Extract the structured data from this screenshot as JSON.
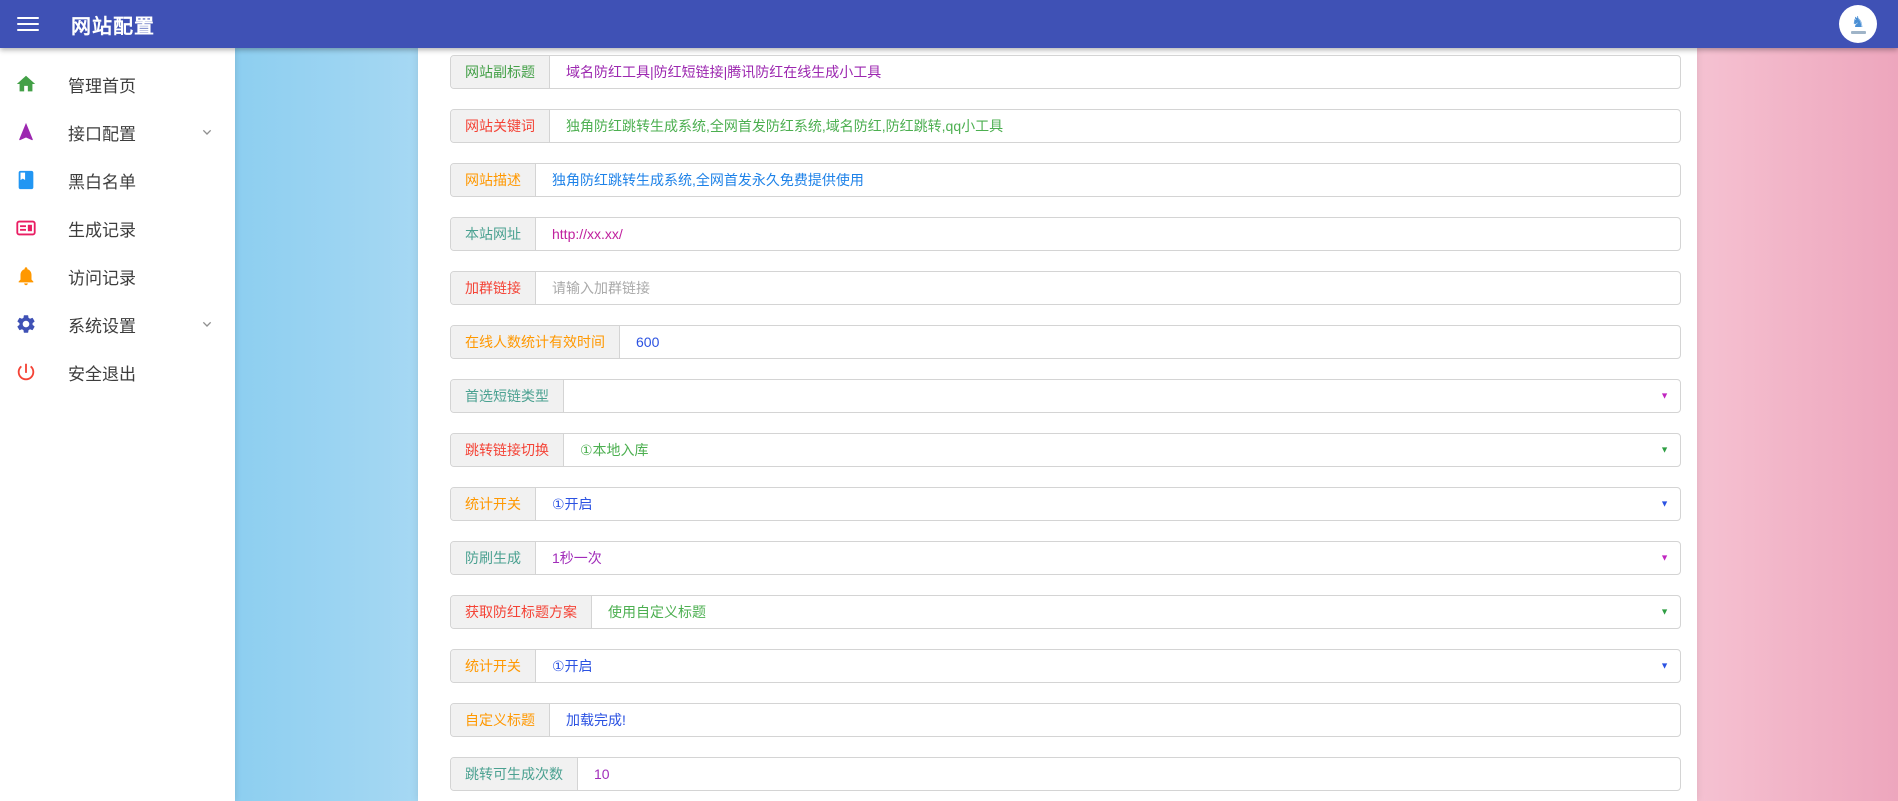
{
  "header": {
    "title": "网站配置",
    "menu_icon": "hamburger-icon",
    "avatar": {
      "icon": "unicorn-logo-icon",
      "glyph": "♞"
    }
  },
  "sidebar": {
    "items": [
      {
        "label": "管理首页",
        "icon": "home-icon",
        "icon_color": "#43a047",
        "expandable": false
      },
      {
        "label": "接口配置",
        "icon": "navigation-icon",
        "icon_color": "#9c27b0",
        "expandable": true
      },
      {
        "label": "黑白名单",
        "icon": "book-icon",
        "icon_color": "#2196f3",
        "expandable": false
      },
      {
        "label": "生成记录",
        "icon": "card-icon",
        "icon_color": "#e91e63",
        "expandable": false
      },
      {
        "label": "访问记录",
        "icon": "bell-icon",
        "icon_color": "#ff9800",
        "expandable": false
      },
      {
        "label": "系统设置",
        "icon": "gear-icon",
        "icon_color": "#3f51b5",
        "expandable": true
      },
      {
        "label": "安全退出",
        "icon": "power-icon",
        "icon_color": "#f44336",
        "expandable": false
      }
    ]
  },
  "form": {
    "rows": [
      {
        "label": "网站副标题",
        "label_color": "#43a047",
        "type": "text",
        "value": "域名防红工具|防红短链接|腾讯防红在线生成小工具",
        "value_color": "#9c27b0"
      },
      {
        "label": "网站关键词",
        "label_color": "#f44336",
        "type": "text",
        "value": "独角防红跳转生成系统,全网首发防红系统,域名防红,防红跳转,qq小工具",
        "value_color": "#4caf50"
      },
      {
        "label": "网站描述",
        "label_color": "#ff9800",
        "type": "text",
        "value": "独角防红跳转生成系统,全网首发永久免费提供使用",
        "value_color": "#1e82e8"
      },
      {
        "label": "本站网址",
        "label_color": "#4ba191",
        "type": "text",
        "value": "http://xx.xx/",
        "value_color": "#c0219e"
      },
      {
        "label": "加群链接",
        "label_color": "#f44336",
        "type": "text",
        "value": "",
        "placeholder": "请输入加群链接",
        "value_color": "#aaaaaa"
      },
      {
        "label": "在线人数统计有效时间",
        "label_color": "#ff9800",
        "type": "text",
        "value": "600",
        "value_color": "#2b52e2"
      },
      {
        "label": "首选短链类型",
        "label_color": "#4ba191",
        "type": "select",
        "value": "",
        "value_color": "#333333",
        "arrow_color": "#c026c0"
      },
      {
        "label": "跳转链接切换",
        "label_color": "#f44336",
        "type": "select",
        "value": "①本地入库",
        "value_color": "#4caf50",
        "arrow_color": "#2f9e44"
      },
      {
        "label": "统计开关",
        "label_color": "#ff9800",
        "type": "select",
        "value": "①开启",
        "value_color": "#2b52e2",
        "arrow_color": "#2b52e2"
      },
      {
        "label": "防刷生成",
        "label_color": "#4ba191",
        "type": "select",
        "value": "1秒一次",
        "value_color": "#a12cba",
        "arrow_color": "#c026c0"
      },
      {
        "label": "获取防红标题方案",
        "label_color": "#f44336",
        "type": "select",
        "value": "使用自定义标题",
        "value_color": "#4caf50",
        "arrow_color": "#2f9e44"
      },
      {
        "label": "统计开关",
        "label_color": "#ff9800",
        "type": "select",
        "value": "①开启",
        "value_color": "#2b52e2",
        "arrow_color": "#2b52e2"
      },
      {
        "label": "自定义标题",
        "label_color": "#ff9800",
        "type": "text",
        "value": "加载完成!",
        "value_color": "#2b52e2"
      },
      {
        "label": "跳转可生成次数",
        "label_color": "#4ba191",
        "type": "text",
        "value": "10",
        "value_color": "#a12cba"
      }
    ]
  }
}
